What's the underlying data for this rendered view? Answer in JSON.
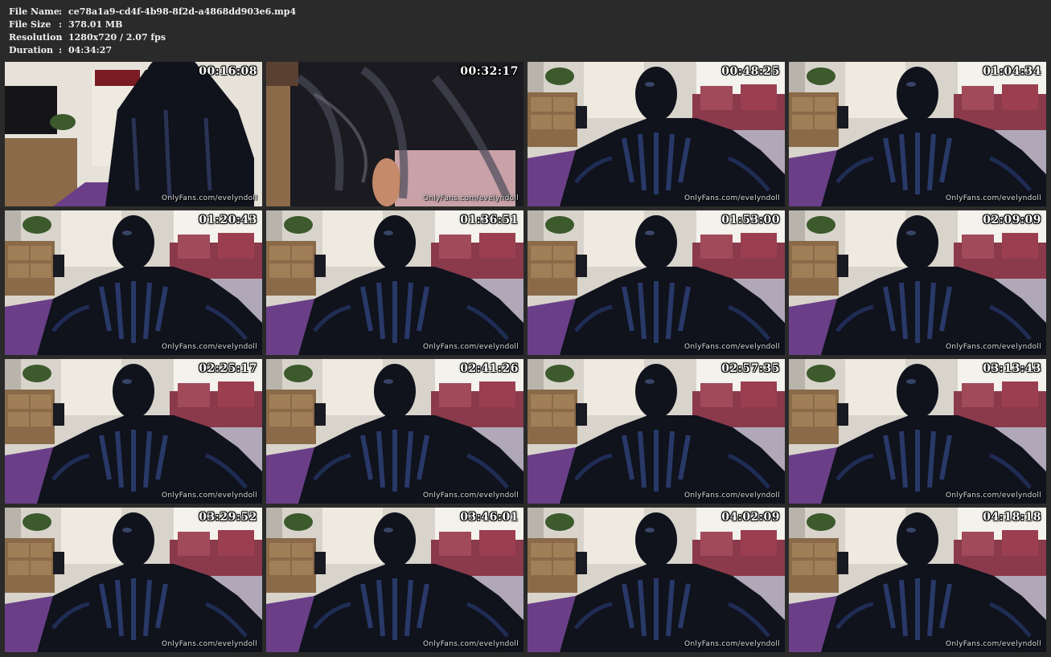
{
  "info": {
    "file_name_label": "File Name",
    "file_name": "ce78a1a9-cd4f-4b98-8f2d-a4868dd903e6.mp4",
    "file_size_label": "File Size",
    "file_size": "378.01 MB",
    "resolution_label": "Resolution",
    "resolution": "1280x720 / 2.07 fps",
    "duration_label": "Duration",
    "duration": "04:34:27",
    "separator": ":"
  },
  "thumbnails": [
    {
      "timestamp": "00:16:08",
      "watermark": "OnlyFans.com/evelyndoll",
      "scene": "closeup-a"
    },
    {
      "timestamp": "00:32:17",
      "watermark": "OnlyFans.com/evelyndoll",
      "scene": "closeup-b"
    },
    {
      "timestamp": "00:48:25",
      "watermark": "OnlyFans.com/evelyndoll",
      "scene": "seated"
    },
    {
      "timestamp": "01:04:34",
      "watermark": "OnlyFans.com/evelyndoll",
      "scene": "seated"
    },
    {
      "timestamp": "01:20:43",
      "watermark": "OnlyFans.com/evelyndoll",
      "scene": "seated"
    },
    {
      "timestamp": "01:36:51",
      "watermark": "OnlyFans.com/evelyndoll",
      "scene": "seated"
    },
    {
      "timestamp": "01:53:00",
      "watermark": "OnlyFans.com/evelyndoll",
      "scene": "seated"
    },
    {
      "timestamp": "02:09:09",
      "watermark": "OnlyFans.com/evelyndoll",
      "scene": "seated"
    },
    {
      "timestamp": "02:25:17",
      "watermark": "OnlyFans.com/evelyndoll",
      "scene": "seated"
    },
    {
      "timestamp": "02:41:26",
      "watermark": "OnlyFans.com/evelyndoll",
      "scene": "seated"
    },
    {
      "timestamp": "02:57:35",
      "watermark": "OnlyFans.com/evelyndoll",
      "scene": "seated"
    },
    {
      "timestamp": "03:13:43",
      "watermark": "OnlyFans.com/evelyndoll",
      "scene": "seated"
    },
    {
      "timestamp": "03:29:52",
      "watermark": "OnlyFans.com/evelyndoll",
      "scene": "seated"
    },
    {
      "timestamp": "03:46:01",
      "watermark": "OnlyFans.com/evelyndoll",
      "scene": "seated"
    },
    {
      "timestamp": "04:02:09",
      "watermark": "OnlyFans.com/evelyndoll",
      "scene": "seated"
    },
    {
      "timestamp": "04:18:18",
      "watermark": "OnlyFans.com/evelyndoll",
      "scene": "seated"
    }
  ],
  "colors": {
    "background": "#2a2a2a",
    "text": "#f0f0f0",
    "wall": "#d8d4cc",
    "curtain": "#eeeae0",
    "carpet": "#6a3f88",
    "latex": "#10121c",
    "latex_highlight": "#3c5aa8",
    "wood": "#8a6a48",
    "sofa": "#8a3a4a"
  }
}
